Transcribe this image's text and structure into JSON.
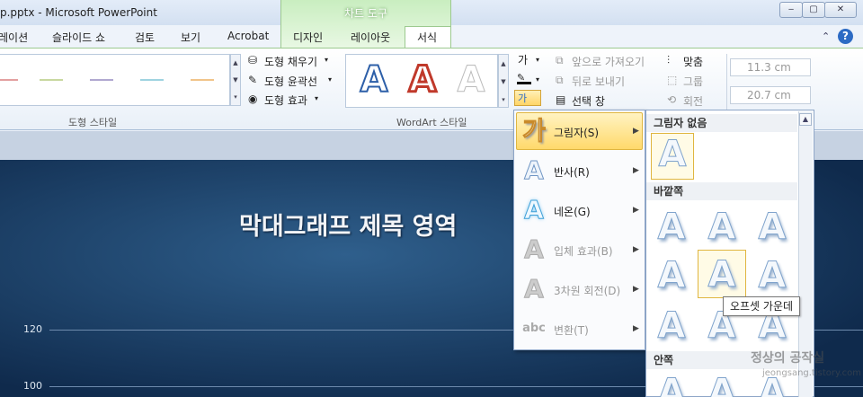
{
  "window": {
    "title": "p.pptx - Microsoft PowerPoint",
    "context_tab": "차트 도구",
    "min": "‒",
    "max": "▢",
    "close": "✕"
  },
  "tabs": [
    "레이션",
    "슬라이드 쇼",
    "검토",
    "보기",
    "Acrobat",
    "디자인",
    "레이아웃",
    "서식"
  ],
  "ribbon": {
    "shape_fill": "도형 채우기",
    "shape_outline": "도형 윤곽선",
    "shape_effect": "도형 효과",
    "shape_styles_label": "도형 스타일",
    "wordart_label": "WordArt 스타일",
    "wordart_glyph": "A",
    "ga": "가",
    "bring_forward": "앞으로 가져오기",
    "send_backward": "뒤로 보내기",
    "selection_pane": "선택 창",
    "align": "맞춤",
    "group": "그룹",
    "rotate": "회전",
    "height": "11.3 cm",
    "width": "20.7 cm",
    "line_colors": [
      "#e3a0a0",
      "#c8d8a0",
      "#b0a8d0",
      "#9fd3e0",
      "#f1c48a"
    ]
  },
  "slide": {
    "title": "막대그래프 제목 영역",
    "ticks": [
      "120",
      "100"
    ]
  },
  "menu": [
    {
      "label": "그림자(S)",
      "icon": "가",
      "enabled": true
    },
    {
      "label": "반사(R)",
      "icon": "A",
      "enabled": true
    },
    {
      "label": "네온(G)",
      "icon": "A",
      "enabled": true
    },
    {
      "label": "입체 효과(B)",
      "icon": "A",
      "enabled": false
    },
    {
      "label": "3차원 회전(D)",
      "icon": "A",
      "enabled": false
    },
    {
      "label": "변환(T)",
      "icon": "abc",
      "enabled": false
    }
  ],
  "gallery": {
    "no_shadow": "그림자 없음",
    "outer": "바깥쪽",
    "inner": "안쪽",
    "glyph": "A",
    "tooltip": "오프셋 가운데"
  },
  "watermark": {
    "line1": "정상의 공작실",
    "line2": "jeongsang.tistory.com"
  }
}
